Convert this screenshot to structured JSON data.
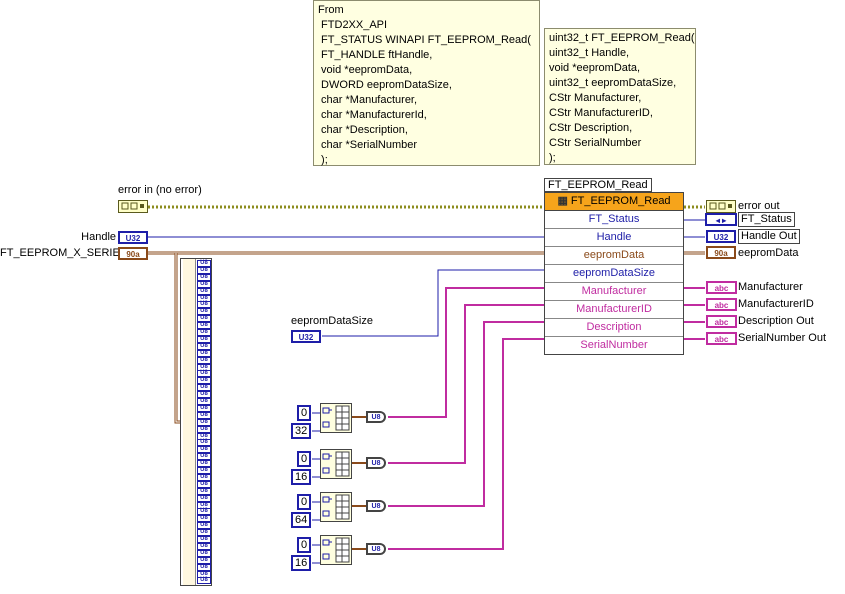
{
  "notes": {
    "api_comment": [
      "From",
      " FTD2XX_API",
      " FT_STATUS WINAPI FT_EEPROM_Read(",
      " FT_HANDLE ftHandle,",
      " void *eepromData,",
      " DWORD eepromDataSize,",
      " char *Manufacturer,",
      " char *ManufacturerId,",
      " char *Description,",
      " char *SerialNumber",
      " );"
    ],
    "lv_comment": [
      "uint32_t FT_EEPROM_Read(",
      "uint32_t Handle,",
      "void *eepromData,",
      "uint32_t eepromDataSize,",
      "CStr Manufacturer,",
      "CStr ManufacturerID,",
      "CStr Description,",
      "CStr SerialNumber",
      ");"
    ]
  },
  "inputs": {
    "error_in": "error in (no error)",
    "handle": "Handle",
    "eeprom_x_series": "FT_EEPROM_X_SERIES",
    "eeprom_data_size": "eepromDataSize"
  },
  "terminals": {
    "u32": "U32",
    "u8": "U8",
    "abc": "abc",
    "ft": "◂ ▸",
    "err": "",
    "series": "90a"
  },
  "node": {
    "title": "FT_EEPROM_Read",
    "header": "FT_EEPROM_Read",
    "params": [
      {
        "label": "FT_Status",
        "color": "#1e1ea8"
      },
      {
        "label": "Handle",
        "color": "#1e1ea8"
      },
      {
        "label": "eepromData",
        "color": "#8a4a1a"
      },
      {
        "label": "eepromDataSize",
        "color": "#1e1ea8"
      },
      {
        "label": "Manufacturer",
        "color": "#c02ca0"
      },
      {
        "label": "ManufacturerID",
        "color": "#c02ca0"
      },
      {
        "label": "Description",
        "color": "#c02ca0"
      },
      {
        "label": "SerialNumber",
        "color": "#c02ca0"
      }
    ]
  },
  "outputs": {
    "error_out": "error out",
    "ft_status": "FT_Status",
    "handle_out": "Handle Out",
    "eeprom_data": "eepromData",
    "manufacturer": "Manufacturer",
    "manufacturer_id": "ManufacturerID",
    "description_out": "Description Out",
    "serial_number_out": "SerialNumber Out"
  },
  "constants": {
    "init_value": "0",
    "sizes": [
      "32",
      "16",
      "64",
      "16"
    ]
  },
  "array_element_labels": [
    "U8",
    "U8",
    "U8",
    "U8",
    "U8",
    "U8",
    "U8",
    "U8",
    "U8",
    "U8",
    "U8",
    "U8",
    "U8",
    "U8",
    "U8",
    "U8",
    "U8",
    "U8",
    "U8",
    "U8",
    "U8",
    "U8",
    "U8",
    "U8",
    "U8",
    "U8",
    "U8",
    "U8",
    "U8",
    "U8",
    "U8",
    "U8",
    "U8",
    "U8",
    "U8",
    "U8",
    "U8",
    "U8",
    "U8",
    "U8",
    "U8",
    "U8",
    "U8",
    "U8",
    "U8",
    "U8",
    "U8"
  ],
  "colors": {
    "wire_blue": "#1e1ea8",
    "wire_brown": "#8a4a1a",
    "wire_pink": "#c02ca0",
    "wire_error": "#8c8c1e",
    "node_header": "#f6a41b",
    "note_bg": "#ffffe1"
  }
}
